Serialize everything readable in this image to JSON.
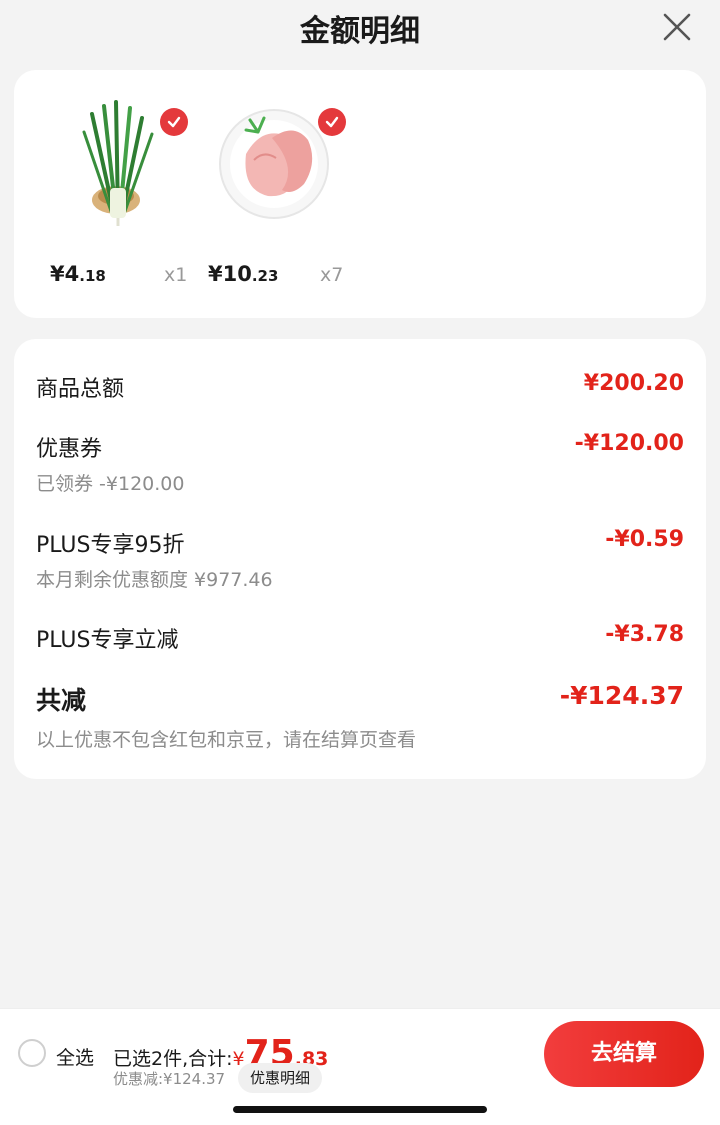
{
  "header": {
    "title": "金额明细"
  },
  "products": [
    {
      "name": "scallion",
      "price_currency": "¥",
      "price_int": "4",
      "price_dec": ".18",
      "qty": "x1",
      "checked": true
    },
    {
      "name": "chicken-breast",
      "price_currency": "¥",
      "price_int": "10",
      "price_dec": ".23",
      "qty": "x7",
      "checked": true
    }
  ],
  "details": {
    "goods_total": {
      "label": "商品总额",
      "value": "¥200.20"
    },
    "coupon": {
      "label": "优惠券",
      "sub": "已领券 -¥120.00",
      "value": "-¥120.00"
    },
    "plus_discount": {
      "label": "PLUS专享95折",
      "sub": "本月剩余优惠额度 ¥977.46",
      "value": "-¥0.59"
    },
    "plus_reduction": {
      "label": "PLUS专享立减",
      "value": "-¥3.78"
    },
    "total_reduction": {
      "label": "共减",
      "value": "-¥124.37"
    },
    "note": "以上优惠不包含红包和京豆，请在结算页查看"
  },
  "bottom_bar": {
    "select_all": "全选",
    "summary_prefix": "已选2件,合计:",
    "currency": "¥",
    "total_int": "75",
    "total_dec": ".83",
    "discount_note": "优惠减:¥124.37",
    "detail_chip": "优惠明细",
    "checkout": "去结算"
  },
  "colors": {
    "accent": "#e2231a",
    "background": "#f3f3f3"
  },
  "icons": {
    "close": "close-icon",
    "check": "check-icon"
  }
}
